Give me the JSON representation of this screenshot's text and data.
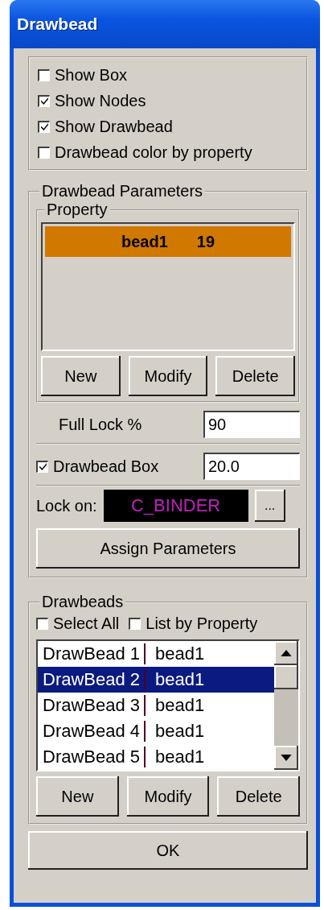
{
  "window": {
    "title": "Drawbead"
  },
  "display_options": [
    {
      "label": "Show Box",
      "checked": false
    },
    {
      "label": "Show Nodes",
      "checked": true
    },
    {
      "label": "Show Drawbead",
      "checked": true
    },
    {
      "label": "Drawbead color by property",
      "checked": false
    }
  ],
  "parameters": {
    "title": "Drawbead Parameters",
    "property": {
      "title": "Property",
      "rows": [
        {
          "name": "bead1",
          "value": "19",
          "selected": true
        }
      ],
      "buttons": [
        "New",
        "Modify",
        "Delete"
      ]
    },
    "full_lock": {
      "label": "Full Lock %",
      "value": "90"
    },
    "drawbead_box": {
      "label": "Drawbead Box",
      "checked": true,
      "value": "20.0"
    },
    "lock_on": {
      "label": "Lock on:",
      "value": "C_BINDER",
      "browse": "..."
    },
    "assign_button": "Assign Parameters"
  },
  "drawbeads": {
    "title": "Drawbeads",
    "options": [
      {
        "label": "Select All",
        "checked": false
      },
      {
        "label": "List by Property",
        "checked": false
      }
    ],
    "rows": [
      {
        "name": "DrawBead 1",
        "property": "bead1",
        "selected": false
      },
      {
        "name": "DrawBead 2",
        "property": "bead1",
        "selected": true
      },
      {
        "name": "DrawBead 3",
        "property": "bead1",
        "selected": false
      },
      {
        "name": "DrawBead 4",
        "property": "bead1",
        "selected": false
      },
      {
        "name": "DrawBead 5",
        "property": "bead1",
        "selected": false
      }
    ],
    "buttons": [
      "New",
      "Modify",
      "Delete"
    ]
  },
  "ok_button": "OK"
}
